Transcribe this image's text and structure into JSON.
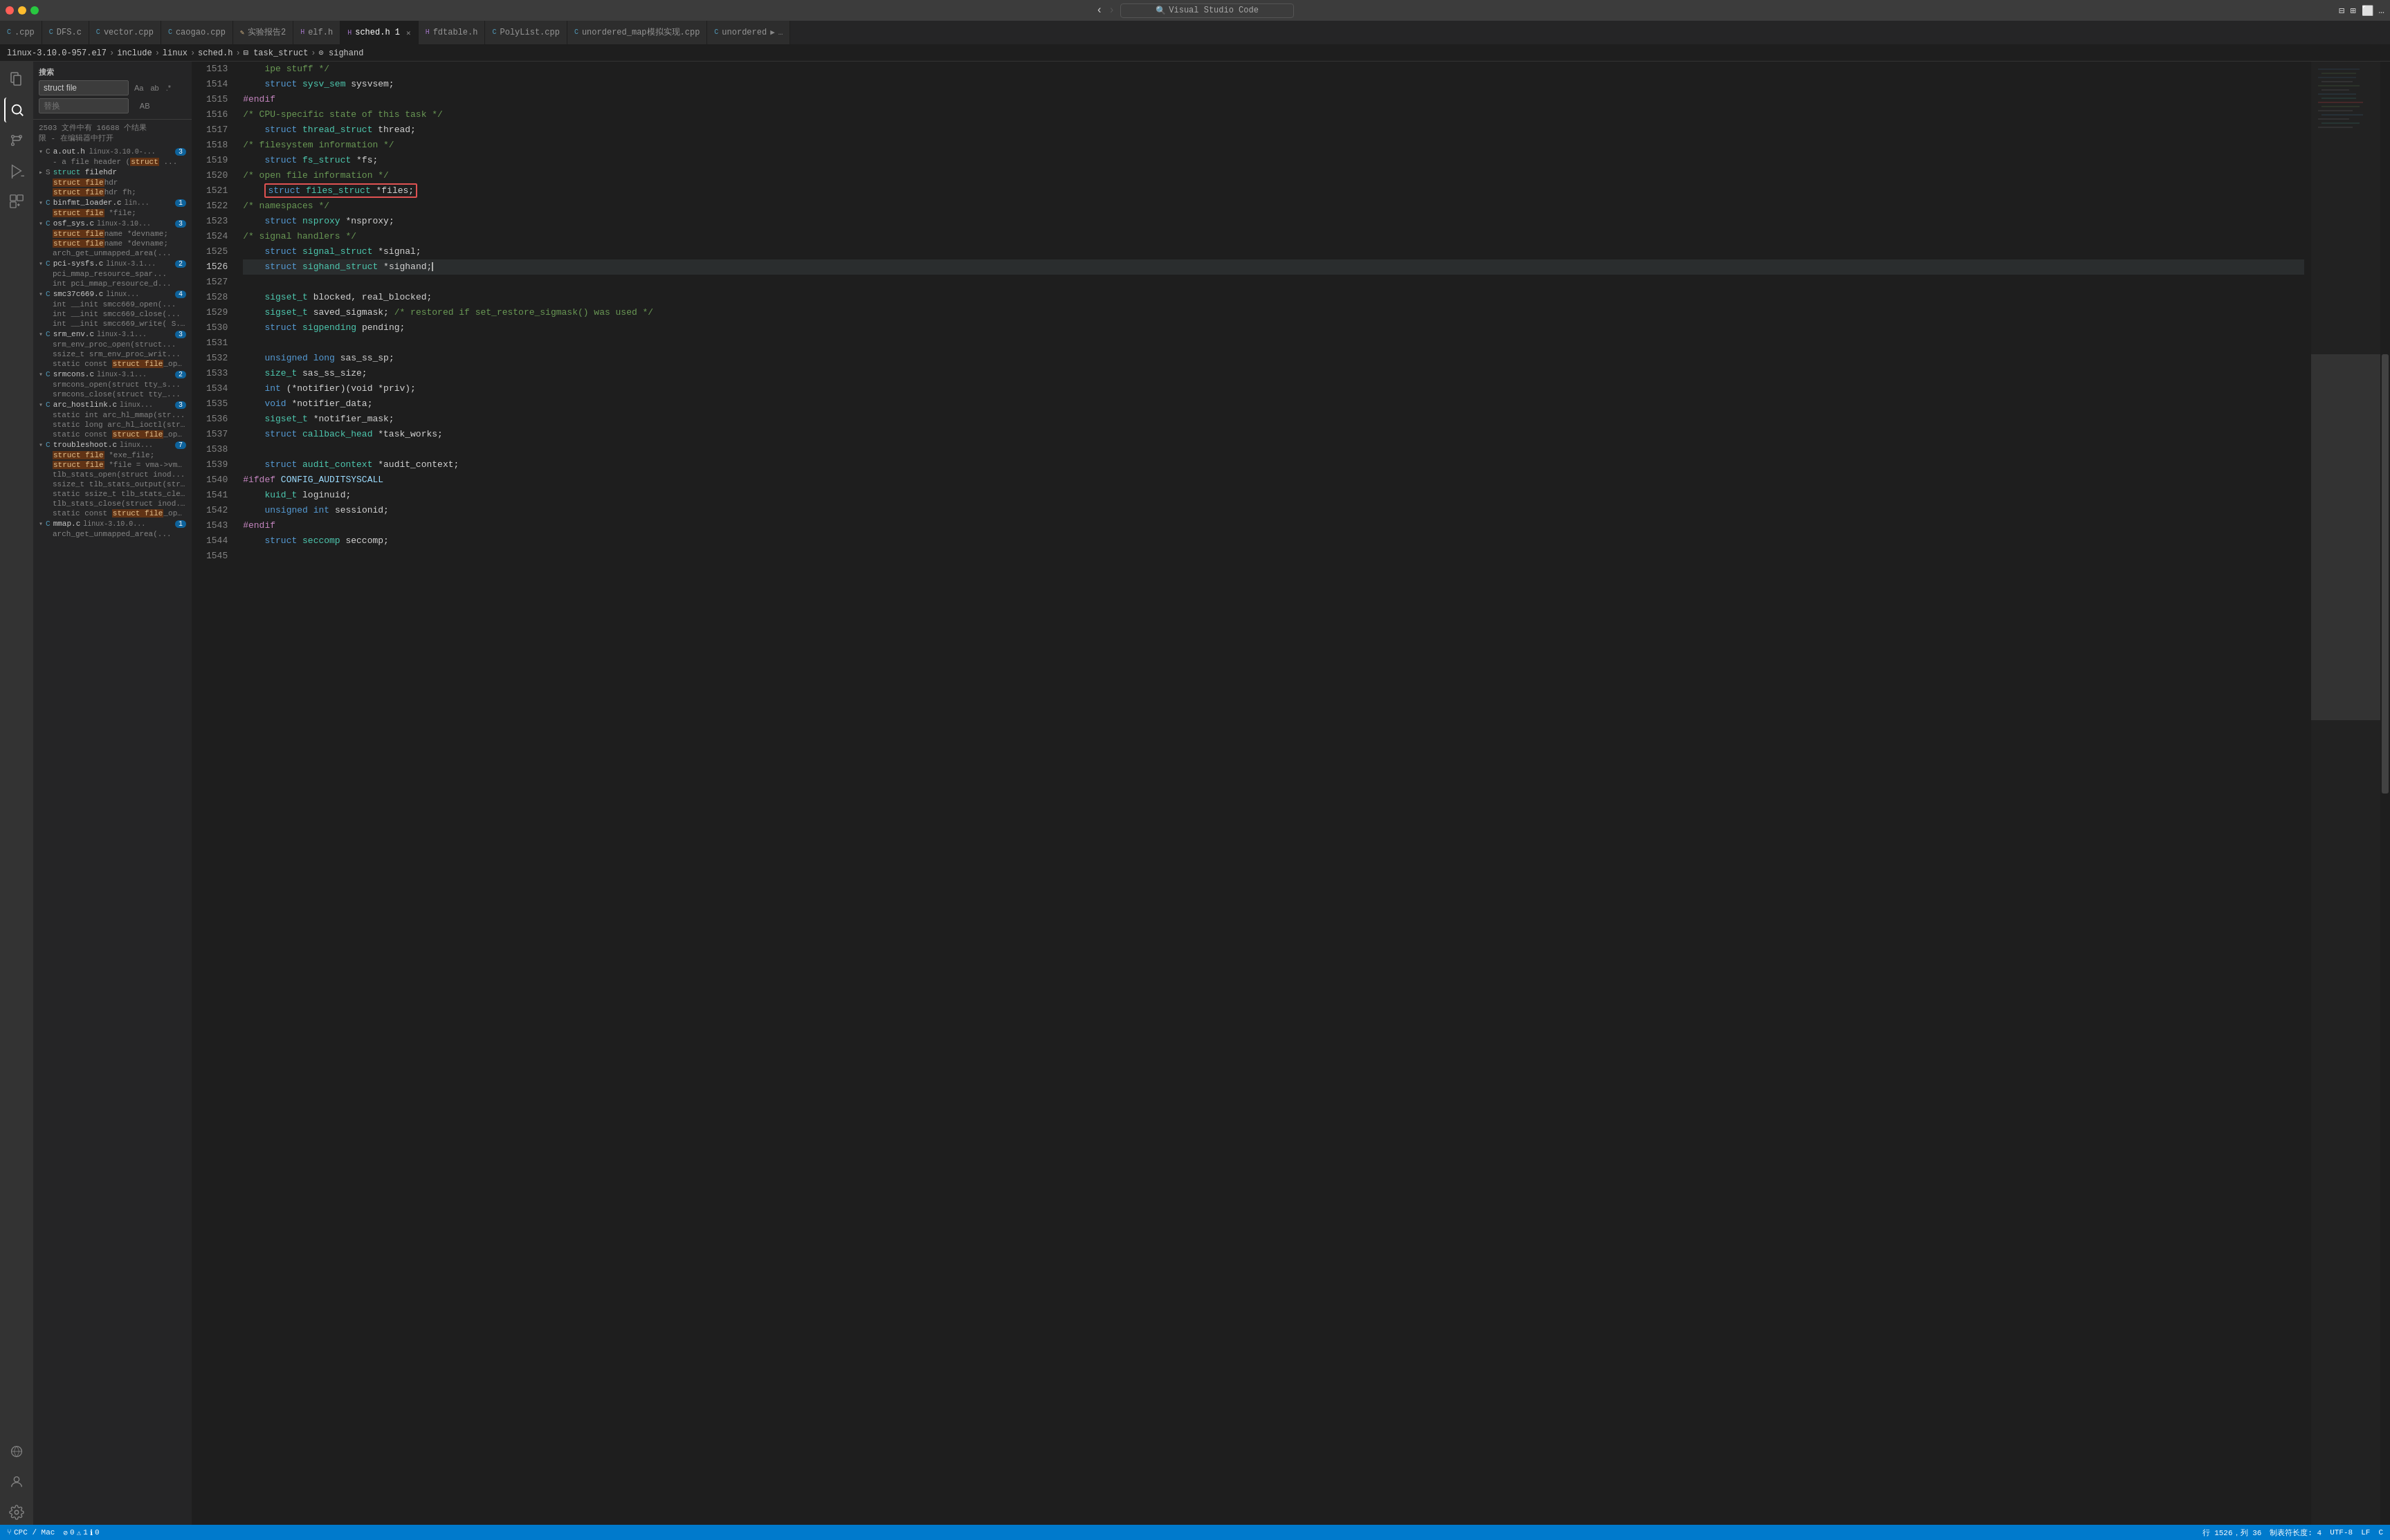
{
  "titleBar": {
    "title": "Visual Studio Code",
    "searchPlaceholder": "Visual Studio Code"
  },
  "tabs": [
    {
      "label": ".cpp",
      "icon": "cpp",
      "active": false,
      "dot": false
    },
    {
      "label": "DFS.c",
      "icon": "c",
      "active": false,
      "dot": false
    },
    {
      "label": "vector.cpp",
      "icon": "cpp",
      "active": false,
      "dot": false
    },
    {
      "label": "caogao.cpp",
      "icon": "cpp",
      "active": false,
      "dot": false
    },
    {
      "label": "实验报告2",
      "icon": "pencil",
      "active": false,
      "dot": false
    },
    {
      "label": "elf.h",
      "icon": "h",
      "active": false,
      "dot": false
    },
    {
      "label": "sched.h 1",
      "icon": "h",
      "active": true,
      "dot": false,
      "modified": true
    },
    {
      "label": "fdtable.h",
      "icon": "h",
      "active": false,
      "dot": false
    },
    {
      "label": "PolyList.cpp",
      "icon": "cpp",
      "active": false,
      "dot": false
    },
    {
      "label": "unordered_map模拟实现.cpp",
      "icon": "cpp",
      "active": false,
      "dot": false
    },
    {
      "label": "unordered",
      "icon": "cpp",
      "active": false,
      "dot": false
    }
  ],
  "breadcrumb": {
    "parts": [
      "linux-3.10.0-957.el7",
      "include",
      "linux",
      "sched.h",
      "task_struct",
      "sighand"
    ]
  },
  "sidebar": {
    "title": "搜索",
    "searchValue": "struct file",
    "searchPlaceholder": "struct file",
    "replacePlaceholder": "替换",
    "resultCount": "2503 文件中有 16688 个结果",
    "resultCountSub": "限 - 在编辑器中打开",
    "results": [
      {
        "file": "a.out.h",
        "path": "linux-3.10.0-...",
        "icon": "h",
        "count": 3,
        "expanded": true,
        "matches": [
          "- a file header (struct ..."
        ]
      },
      {
        "file": "filehdr",
        "path": "",
        "icon": "struct",
        "count": 0,
        "expanded": false,
        "matches": [
          "struct filehdr",
          "struct filehdr    fh;"
        ]
      },
      {
        "file": "binfmt_loader.c",
        "path": "lin...",
        "icon": "c",
        "count": 1,
        "expanded": true,
        "matches": [
          "struct file *file;"
        ]
      },
      {
        "file": "osf_sys.c",
        "path": "linux-3.10...",
        "icon": "c",
        "count": 3,
        "expanded": true,
        "matches": [
          "struct filename *devname;",
          "struct filename *devname;",
          "arch_get_unmapped_area(..."
        ]
      },
      {
        "file": "pci-sysfs.c",
        "path": "linux-3.1...",
        "icon": "c",
        "count": 2,
        "expanded": true,
        "matches": [
          "pci_mmap_resource_spar...",
          "int pci_mmap_resource_d..."
        ]
      },
      {
        "file": "smc37c669.c",
        "path": "linux...",
        "icon": "c",
        "count": 4,
        "expanded": true,
        "matches": [
          "int __init smcc669_open(...",
          "int __init smcc669_close(...",
          "int __init smcc669_write( S..."
        ]
      },
      {
        "file": "srm_env.c",
        "path": "linux-3.1...",
        "icon": "c",
        "count": 3,
        "expanded": true,
        "matches": [
          "srm_env_proc_open(struct...",
          "ssize_t srm_env_proc_writ...",
          "static const struct file_ope..."
        ]
      },
      {
        "file": "srmcons.c",
        "path": "linux-3.1...",
        "icon": "c",
        "count": 2,
        "expanded": true,
        "matches": [
          "srmcons_open(struct tty_s...",
          "srmcons_close(struct tty_..."
        ]
      },
      {
        "file": "arc_hostlink.c",
        "path": "linux...",
        "icon": "c",
        "count": 3,
        "expanded": true,
        "matches": [
          "static int arc_hl_mmap(str...",
          "static long arc_hl_ioctl(str...",
          "static const struct file_ope..."
        ]
      },
      {
        "file": "troubleshoot.c",
        "path": "linux...",
        "icon": "c",
        "count": 7,
        "expanded": true,
        "matches": [
          "struct file *exe_file;",
          "struct file *file = vma->vm...",
          "tlb_stats_open(struct inod...",
          "ssize_t tlb_stats_output(str...",
          "static ssize_t tlb_stats_cle...",
          "tlb_stats_close(struct inod...",
          "static const struct file_ope..."
        ]
      },
      {
        "file": "mmap.c",
        "path": "linux-3.10.0...",
        "icon": "c",
        "count": 1,
        "expanded": true,
        "matches": [
          "arch_get_unmapped_area(..."
        ]
      }
    ]
  },
  "editor": {
    "filename": "sched.h",
    "lines": [
      {
        "num": 1513,
        "content": "    ipe stuff */",
        "tokens": [
          {
            "text": "    ipe stuff */",
            "class": "comment"
          }
        ]
      },
      {
        "num": 1514,
        "content": "    struct sysv_sem sysvsem;",
        "tokens": [
          {
            "text": "    struct ",
            "class": "kw"
          },
          {
            "text": "sysv_sem ",
            "class": "type"
          },
          {
            "text": "sysvsem;",
            "class": "plain"
          }
        ]
      },
      {
        "num": 1515,
        "content": "#endif",
        "tokens": [
          {
            "text": "#endif",
            "class": "kw2"
          }
        ]
      },
      {
        "num": 1516,
        "content": "/* CPU-specific state of this task */",
        "tokens": [
          {
            "text": "/* CPU-specific state of this task */",
            "class": "comment"
          }
        ]
      },
      {
        "num": 1517,
        "content": "    struct thread_struct thread;",
        "tokens": [
          {
            "text": "    struct ",
            "class": "kw"
          },
          {
            "text": "thread_struct ",
            "class": "type"
          },
          {
            "text": "thread;",
            "class": "plain"
          }
        ]
      },
      {
        "num": 1518,
        "content": "/* filesystem information */",
        "tokens": [
          {
            "text": "/* filesystem information */",
            "class": "comment"
          }
        ]
      },
      {
        "num": 1519,
        "content": "    struct fs_struct *fs;",
        "tokens": [
          {
            "text": "    struct ",
            "class": "kw"
          },
          {
            "text": "fs_struct ",
            "class": "type"
          },
          {
            "text": "*fs;",
            "class": "plain"
          }
        ]
      },
      {
        "num": 1520,
        "content": "/* open file information */",
        "tokens": [
          {
            "text": "/* open file information */",
            "class": "comment"
          }
        ]
      },
      {
        "num": 1521,
        "content": "    struct files_struct *files;",
        "tokens": [
          {
            "text": "    struct files_struct *files;",
            "class": "highlight"
          }
        ]
      },
      {
        "num": 1522,
        "content": "/* namespaces */",
        "tokens": [
          {
            "text": "/* namespaces */",
            "class": "comment"
          }
        ]
      },
      {
        "num": 1523,
        "content": "    struct nsproxy *nsproxy;",
        "tokens": [
          {
            "text": "    struct ",
            "class": "kw"
          },
          {
            "text": "nsproxy ",
            "class": "type"
          },
          {
            "text": "*nsproxy;",
            "class": "plain"
          }
        ]
      },
      {
        "num": 1524,
        "content": "/* signal handlers */",
        "tokens": [
          {
            "text": "/* signal handlers */",
            "class": "comment"
          }
        ]
      },
      {
        "num": 1525,
        "content": "    struct signal_struct *signal;",
        "tokens": [
          {
            "text": "    struct ",
            "class": "kw"
          },
          {
            "text": "signal_struct ",
            "class": "type"
          },
          {
            "text": "*signal;",
            "class": "plain"
          }
        ]
      },
      {
        "num": 1526,
        "content": "    struct sighand_struct *sighand;",
        "tokens": [
          {
            "text": "    struct ",
            "class": "kw"
          },
          {
            "text": "sighand_struct ",
            "class": "type"
          },
          {
            "text": "*sighand;",
            "class": "plain"
          }
        ]
      },
      {
        "num": 1527,
        "content": "",
        "tokens": []
      },
      {
        "num": 1528,
        "content": "    sigset_t blocked, real_blocked;",
        "tokens": [
          {
            "text": "    ",
            "class": "plain"
          },
          {
            "text": "sigset_t ",
            "class": "type"
          },
          {
            "text": "blocked, real_blocked;",
            "class": "plain"
          }
        ]
      },
      {
        "num": 1529,
        "content": "    sigset_t saved_sigmask; /* restored if set_restore_sigmask() was used */",
        "tokens": [
          {
            "text": "    ",
            "class": "plain"
          },
          {
            "text": "sigset_t ",
            "class": "type"
          },
          {
            "text": "saved_sigmask; ",
            "class": "plain"
          },
          {
            "text": "/* restored if set_restore_sigmask() was used */",
            "class": "comment"
          }
        ]
      },
      {
        "num": 1530,
        "content": "    struct sigpending pending;",
        "tokens": [
          {
            "text": "    struct ",
            "class": "kw"
          },
          {
            "text": "sigpending ",
            "class": "type"
          },
          {
            "text": "pending;",
            "class": "plain"
          }
        ]
      },
      {
        "num": 1531,
        "content": "",
        "tokens": []
      },
      {
        "num": 1532,
        "content": "    unsigned long sas_ss_sp;",
        "tokens": [
          {
            "text": "    unsigned ",
            "class": "kw"
          },
          {
            "text": "long ",
            "class": "kw"
          },
          {
            "text": "sas_ss_sp;",
            "class": "plain"
          }
        ]
      },
      {
        "num": 1533,
        "content": "    size_t sas_ss_size;",
        "tokens": [
          {
            "text": "    size_t ",
            "class": "type"
          },
          {
            "text": "sas_ss_size;",
            "class": "plain"
          }
        ]
      },
      {
        "num": 1534,
        "content": "    int (*notifier)(void *priv);",
        "tokens": [
          {
            "text": "    int ",
            "class": "kw"
          },
          {
            "text": "(*notifier)(void ",
            "class": "plain"
          },
          {
            "text": "*priv);",
            "class": "plain"
          }
        ]
      },
      {
        "num": 1535,
        "content": "    void *notifier_data;",
        "tokens": [
          {
            "text": "    void ",
            "class": "kw"
          },
          {
            "text": "*notifier_data;",
            "class": "plain"
          }
        ]
      },
      {
        "num": 1536,
        "content": "    sigset_t *notifier_mask;",
        "tokens": [
          {
            "text": "    ",
            "class": "plain"
          },
          {
            "text": "sigset_t ",
            "class": "type"
          },
          {
            "text": "*notifier_mask;",
            "class": "plain"
          }
        ]
      },
      {
        "num": 1537,
        "content": "    struct callback_head *task_works;",
        "tokens": [
          {
            "text": "    struct ",
            "class": "kw"
          },
          {
            "text": "callback_head ",
            "class": "type"
          },
          {
            "text": "*task_works;",
            "class": "plain"
          }
        ]
      },
      {
        "num": 1538,
        "content": "",
        "tokens": []
      },
      {
        "num": 1539,
        "content": "    struct audit_context *audit_context;",
        "tokens": [
          {
            "text": "    struct ",
            "class": "kw"
          },
          {
            "text": "audit_context ",
            "class": "type"
          },
          {
            "text": "*audit_context;",
            "class": "plain"
          }
        ]
      },
      {
        "num": 1540,
        "content": "#ifdef CONFIG_AUDITSYSCALL",
        "tokens": [
          {
            "text": "#ifdef ",
            "class": "kw2"
          },
          {
            "text": "CONFIG_AUDITSYSCALL",
            "class": "ident"
          }
        ]
      },
      {
        "num": 1541,
        "content": "    kuid_t loginuid;",
        "tokens": [
          {
            "text": "    kuid_t ",
            "class": "type"
          },
          {
            "text": "loginuid;",
            "class": "plain"
          }
        ]
      },
      {
        "num": 1542,
        "content": "    unsigned int sessionid;",
        "tokens": [
          {
            "text": "    unsigned ",
            "class": "kw"
          },
          {
            "text": "int ",
            "class": "kw"
          },
          {
            "text": "sessionid;",
            "class": "plain"
          }
        ]
      },
      {
        "num": 1543,
        "content": "#endif",
        "tokens": [
          {
            "text": "#endif",
            "class": "kw2"
          }
        ]
      },
      {
        "num": 1544,
        "content": "    struct seccomp seccomp;",
        "tokens": [
          {
            "text": "    struct ",
            "class": "kw"
          },
          {
            "text": "seccomp ",
            "class": "type"
          },
          {
            "text": "seccomp;",
            "class": "plain"
          }
        ]
      },
      {
        "num": 1545,
        "content": "",
        "tokens": []
      }
    ]
  },
  "statusBar": {
    "errors": "0",
    "warnings": "1",
    "info": "0",
    "line": "行 1526，列 36",
    "indent": "制表符长度: 4",
    "encoding": "UTF-8",
    "lineEnding": "LF",
    "language": "C",
    "branch": "CPC / Mac"
  },
  "activityIcons": {
    "explorer": "📁",
    "search": "🔍",
    "sourceControl": "⑂",
    "run": "▶",
    "extensions": "⊞",
    "remote": "⊙",
    "settings": "⚙"
  }
}
